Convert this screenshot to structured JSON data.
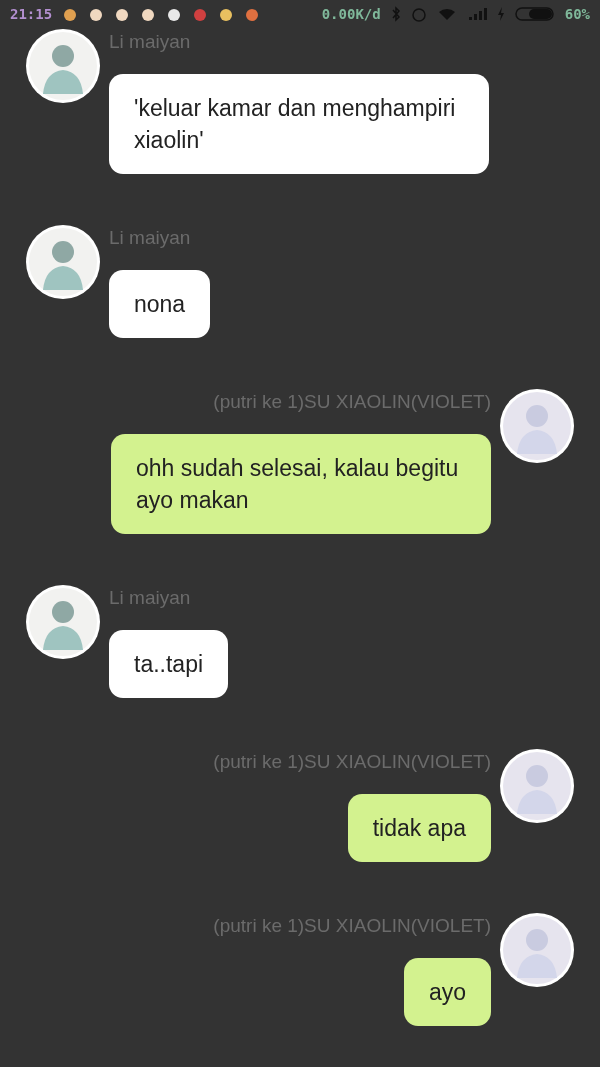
{
  "status_bar": {
    "time": "21:15",
    "network_speed": "0.00K/d",
    "battery": "60%"
  },
  "messages": [
    {
      "kind": "incoming",
      "sender": "Li maiyan",
      "text": "'keluar kamar dan menghampiri xiaolin'"
    },
    {
      "kind": "incoming",
      "sender": "Li maiyan",
      "text": "nona"
    },
    {
      "kind": "outgoing",
      "sender": "(putri ke 1)SU XIAOLIN(VIOLET)",
      "text": "ohh sudah selesai, kalau begitu ayo makan"
    },
    {
      "kind": "incoming",
      "sender": "Li maiyan",
      "text": "ta..tapi"
    },
    {
      "kind": "outgoing",
      "sender": "(putri ke 1)SU XIAOLIN(VIOLET)",
      "text": "tidak apa"
    },
    {
      "kind": "outgoing",
      "sender": "(putri ke 1)SU XIAOLIN(VIOLET)",
      "text": "ayo"
    }
  ]
}
